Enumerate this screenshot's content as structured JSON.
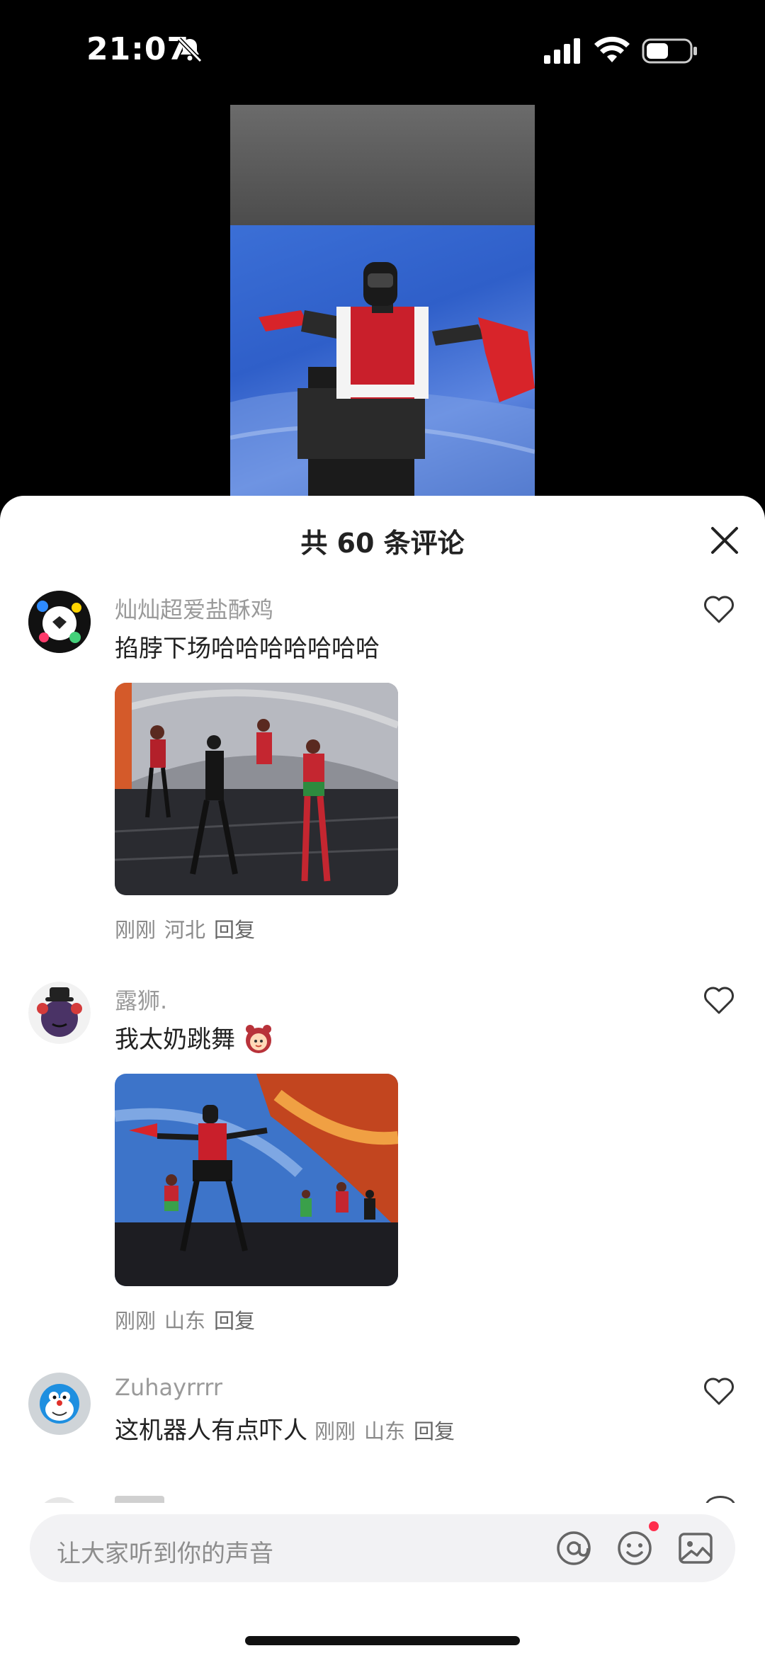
{
  "status_bar": {
    "time": "21:07"
  },
  "sheet": {
    "title": "共 60 条评论",
    "comments": [
      {
        "username": "灿灿超爱盐酥鸡",
        "text": "掐脖下场哈哈哈哈哈哈哈",
        "time": "刚刚",
        "location": "河北",
        "reply_label": "回复"
      },
      {
        "username": "露狮.",
        "text": "我太奶跳舞",
        "time": "刚刚",
        "location": "山东",
        "reply_label": "回复"
      },
      {
        "username": "Zuhayrrrr",
        "text": "这机器人有点吓人",
        "time": "刚刚",
        "location": "山东",
        "reply_label": "回复"
      }
    ]
  },
  "input": {
    "placeholder": "让大家听到你的声音"
  },
  "icons": [
    "bell-muted-icon",
    "signal-icon",
    "wifi-icon",
    "battery-icon",
    "close-icon",
    "heart-icon",
    "at-icon",
    "emoji-icon",
    "image-icon"
  ],
  "colors": {
    "notification_dot": "#ff2e4d"
  }
}
